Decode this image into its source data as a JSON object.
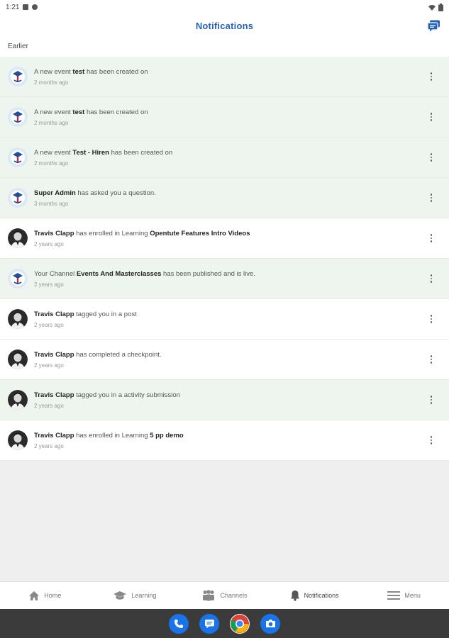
{
  "status_bar": {
    "time": "1:21"
  },
  "header": {
    "title": "Notifications",
    "chat_icon": "chat-bubbles-icon"
  },
  "section": {
    "label": "Earlier"
  },
  "notifications": [
    {
      "parts": [
        "A new event ",
        "test",
        " has been created on"
      ],
      "time": "2 months ago",
      "avatar": "logo",
      "state": "unread"
    },
    {
      "parts": [
        "A new event ",
        "test",
        " has been created on"
      ],
      "time": "2 months ago",
      "avatar": "logo",
      "state": "unread"
    },
    {
      "parts": [
        "A new event ",
        "Test - Hiren",
        " has been created on"
      ],
      "time": "2 months ago",
      "avatar": "logo",
      "state": "unread"
    },
    {
      "parts": [
        "",
        "Super Admin",
        " has asked you a question."
      ],
      "time": "3 months ago",
      "avatar": "logo",
      "state": "unread"
    },
    {
      "parts": [
        "",
        "Travis Clapp",
        " has enrolled in Learning ",
        "Opentute Features Intro Videos",
        ""
      ],
      "time": "2 years ago",
      "avatar": "person",
      "state": "read"
    },
    {
      "parts": [
        "Your Channel ",
        "Events And Masterclasses",
        " has been published and is live."
      ],
      "time": "2 years ago",
      "avatar": "logo",
      "state": "unread"
    },
    {
      "parts": [
        "",
        "Travis Clapp",
        " tagged you in a post"
      ],
      "time": "2 years ago",
      "avatar": "person",
      "state": "read"
    },
    {
      "parts": [
        "",
        "Travis Clapp",
        " has completed a checkpoint."
      ],
      "time": "2 years ago",
      "avatar": "person",
      "state": "read"
    },
    {
      "parts": [
        "",
        "Travis Clapp",
        " tagged you in a activity submission"
      ],
      "time": "2 years ago",
      "avatar": "person",
      "state": "unread"
    },
    {
      "parts": [
        "",
        "Travis Clapp",
        " has enrolled in Learning ",
        "5 pp demo",
        ""
      ],
      "time": "2 years ago",
      "avatar": "person",
      "state": "read"
    }
  ],
  "bottom_nav": [
    {
      "label": "Home",
      "icon": "home-icon",
      "active": false
    },
    {
      "label": "Learning",
      "icon": "graduation-cap-icon",
      "active": false
    },
    {
      "label": "Channels",
      "icon": "people-group-icon",
      "active": false
    },
    {
      "label": "Notifications",
      "icon": "bell-icon",
      "active": true
    },
    {
      "label": "Menu",
      "icon": "hamburger-menu-icon",
      "active": false
    }
  ],
  "dock": [
    {
      "icon": "phone-app-icon",
      "color": "#1a73e8"
    },
    {
      "icon": "messages-app-icon",
      "color": "#1a73e8"
    },
    {
      "icon": "chrome-app-icon",
      "color": "#ffffff"
    },
    {
      "icon": "camera-app-icon",
      "color": "#1a73e8"
    }
  ]
}
